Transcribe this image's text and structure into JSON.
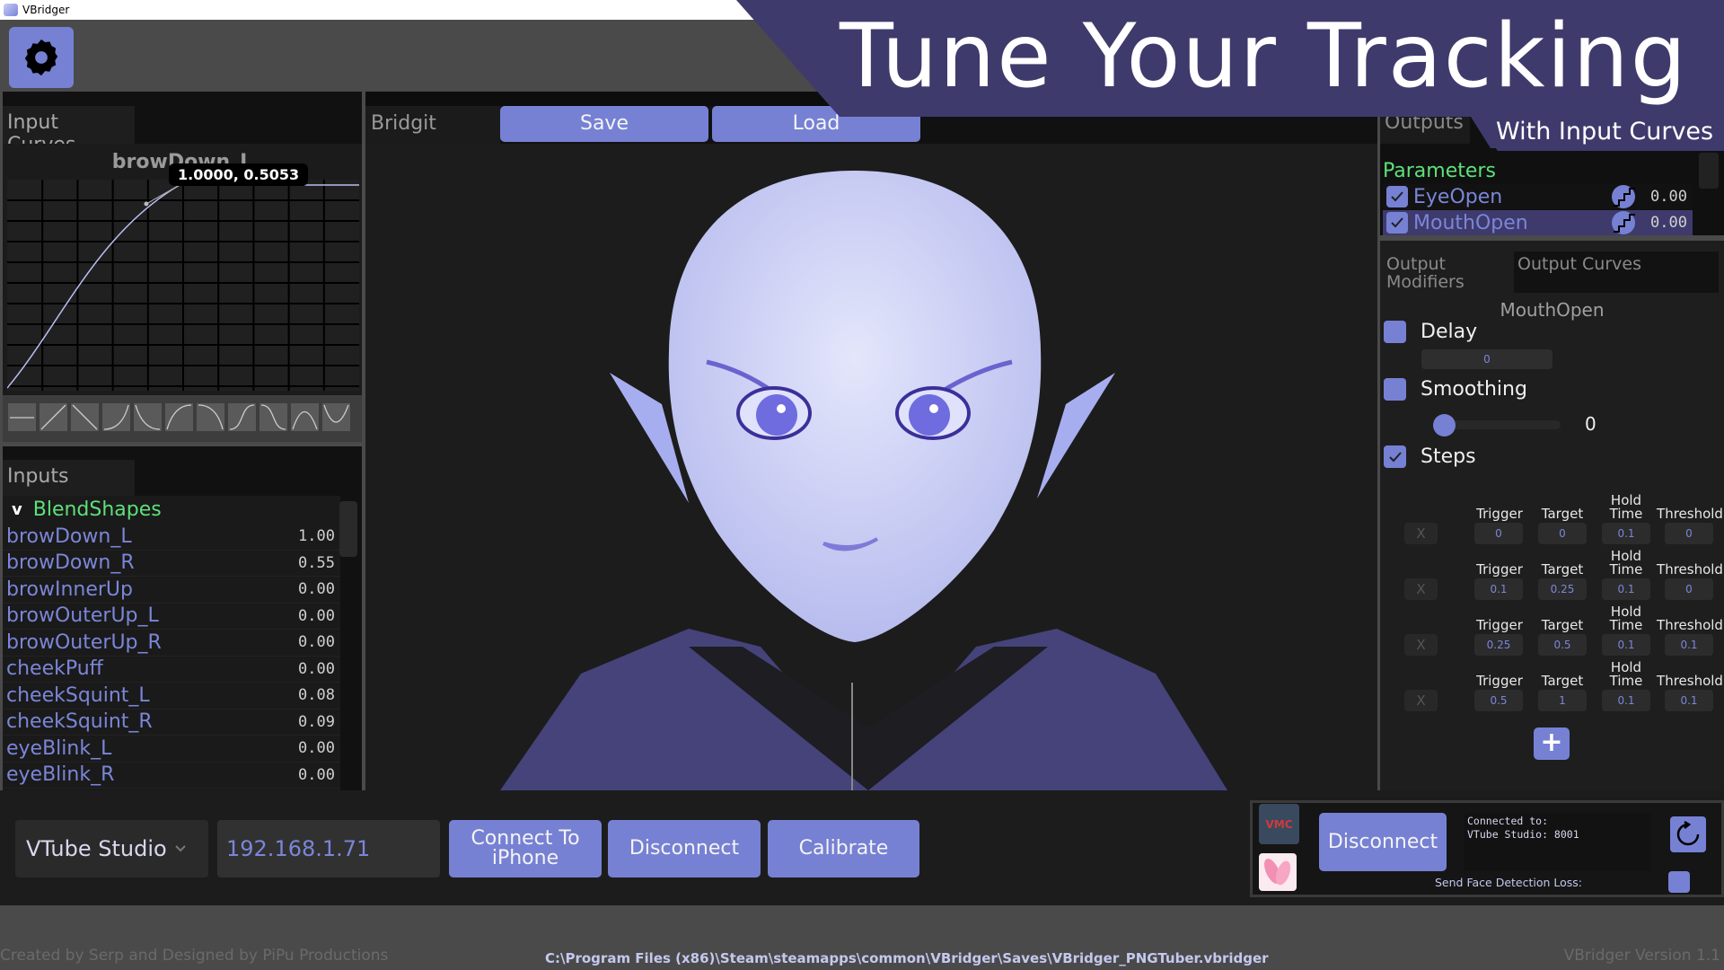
{
  "window": {
    "title": "VBridger"
  },
  "banner": {
    "title": "Tune Your Tracking",
    "subtitle": "With Input Curves"
  },
  "left": {
    "curves_tab": "Input Curves",
    "curve_name": "browDown_L",
    "tooltip": "1.0000, 0.5053",
    "presets": [
      "flat",
      "linear-up",
      "linear-down",
      "ease-in",
      "ease-out-down",
      "ease-out",
      "ease-in-down",
      "s-curve",
      "s-curve-down",
      "peak",
      "valley"
    ],
    "inputs_tab": "Inputs",
    "group": {
      "chevron": "v",
      "label": "BlendShapes"
    },
    "inputs": [
      {
        "name": "browDown_L",
        "value": "1.00"
      },
      {
        "name": "browDown_R",
        "value": "0.55"
      },
      {
        "name": "browInnerUp",
        "value": "0.00"
      },
      {
        "name": "browOuterUp_L",
        "value": "0.00"
      },
      {
        "name": "browOuterUp_R",
        "value": "0.00"
      },
      {
        "name": "cheekPuff",
        "value": "0.00"
      },
      {
        "name": "cheekSquint_L",
        "value": "0.08"
      },
      {
        "name": "cheekSquint_R",
        "value": "0.09"
      },
      {
        "name": "eyeBlink_L",
        "value": "0.00"
      },
      {
        "name": "eyeBlink_R",
        "value": "0.00"
      }
    ]
  },
  "center": {
    "tab": "Bridgit",
    "save_label": "Save",
    "load_label": "Load"
  },
  "right": {
    "outputs_tab": "Outputs",
    "params_label": "Parameters",
    "params": [
      {
        "name": "EyeOpen",
        "value": "0.00",
        "checked": true
      },
      {
        "name": "MouthOpen",
        "value": "0.00",
        "checked": true
      }
    ],
    "mod_tabs": [
      "Output Modifiers",
      "Output Curves"
    ],
    "selected_param": "MouthOpen",
    "delay": {
      "label": "Delay",
      "value": "0",
      "checked": false
    },
    "smoothing": {
      "label": "Smoothing",
      "value": "0",
      "checked": false
    },
    "steps": {
      "label": "Steps",
      "checked": true,
      "headers": {
        "trigger": "Trigger",
        "target": "Target",
        "hold": "Hold Time",
        "threshold": "Threshold",
        "remove": "X"
      },
      "rows": [
        {
          "trigger": "0",
          "target": "0",
          "hold": "0.1",
          "threshold": "0"
        },
        {
          "trigger": "0.1",
          "target": "0.25",
          "hold": "0.1",
          "threshold": "0"
        },
        {
          "trigger": "0.25",
          "target": "0.5",
          "hold": "0.1",
          "threshold": "0.1"
        },
        {
          "trigger": "0.5",
          "target": "1",
          "hold": "0.1",
          "threshold": "0.1"
        }
      ],
      "add_label": "+"
    }
  },
  "bottom": {
    "source": "VTube Studio",
    "ip": "192.168.1.71",
    "connect_label": "Connect To iPhone",
    "disconnect_label": "Disconnect",
    "calibrate_label": "Calibrate",
    "vmc_logo": "VMC",
    "disconnect2_label": "Disconnect",
    "status_line1": "Connected to:",
    "status_line2": "VTube Studio: 8001",
    "send_face_loss_label": "Send Face Detection Loss:"
  },
  "footer": {
    "credits": "Created by Serp and Designed by PiPu Productions",
    "path": "C:\\Program Files (x86)\\Steam\\steamapps\\common\\VBridger\\Saves\\VBridger_PNGTuber.vbridger",
    "version": "VBridger Version 1.1"
  },
  "colors": {
    "accent": "#7681d4",
    "banner": "#3e3a6c",
    "group_green": "#5ee07a",
    "list_text": "#7b86d8"
  }
}
